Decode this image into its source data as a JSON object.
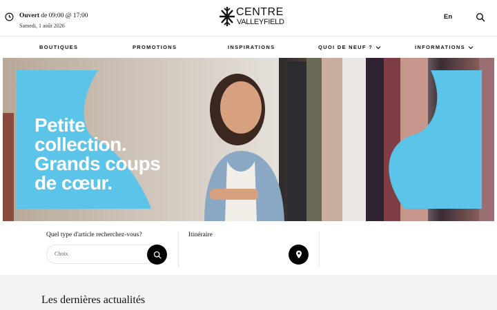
{
  "header": {
    "status_bold": "Ouvert",
    "status_rest": "de 09:00 @ 17:00",
    "date": "Samedi, 1 août 2026",
    "logo_top": "CENTRE",
    "logo_bottom": "VALLEYFIELD",
    "lang_label": "En"
  },
  "nav": {
    "items": [
      {
        "label": "BOUTIQUES"
      },
      {
        "label": "PROMOTIONS"
      },
      {
        "label": "INSPIRATIONS"
      },
      {
        "label": "QUOI DE NEUF ?"
      },
      {
        "label": "INFORMATIONS"
      }
    ]
  },
  "hero": {
    "lines": [
      "Petite",
      "collection.",
      "Grands coups",
      "de cœur."
    ],
    "accent_color": "#5bc4e8"
  },
  "finder": {
    "article_label": "Quel type d'article recherchez-vous?",
    "article_placeholder": "Choix",
    "route_label": "Itinéraire"
  },
  "news": {
    "title": "Les dernières actualités"
  },
  "icons": {
    "clock": "clock-icon",
    "search": "search-icon",
    "chevron": "chevron-down-icon",
    "pin": "map-pin-icon"
  }
}
